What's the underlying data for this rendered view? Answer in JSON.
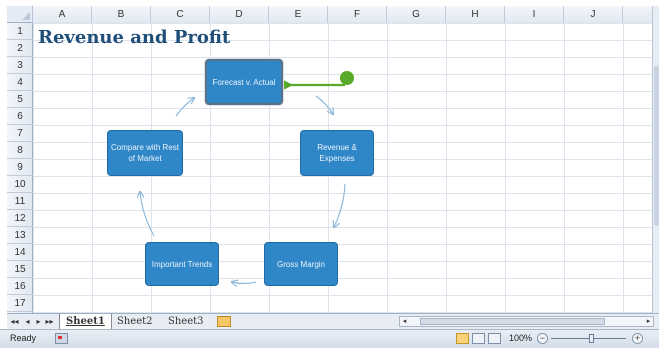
{
  "columns": [
    "A",
    "B",
    "C",
    "D",
    "E",
    "F",
    "G",
    "H",
    "I",
    "J"
  ],
  "rows": [
    "1",
    "2",
    "3",
    "4",
    "5",
    "6",
    "7",
    "8",
    "9",
    "10",
    "11",
    "12",
    "13",
    "14",
    "15",
    "16",
    "17"
  ],
  "title": "Revenue and Profit",
  "diagram": {
    "steps": [
      "Forecast v. Actual",
      "Revenue & Expenses",
      "Gross Margin",
      "Important Trends",
      "Compare with Rest of Market"
    ],
    "color": "#2f87c8",
    "pointer_color": "#5aaa2a"
  },
  "sheet_tabs": [
    "Sheet1",
    "Sheet2",
    "Sheet3"
  ],
  "status": {
    "ready": "Ready",
    "zoom": "100%",
    "zoom_minus": "−",
    "zoom_plus": "+"
  },
  "nav": {
    "first": "◂◂",
    "prev": "◂",
    "next": "▸",
    "last": "▸▸"
  }
}
